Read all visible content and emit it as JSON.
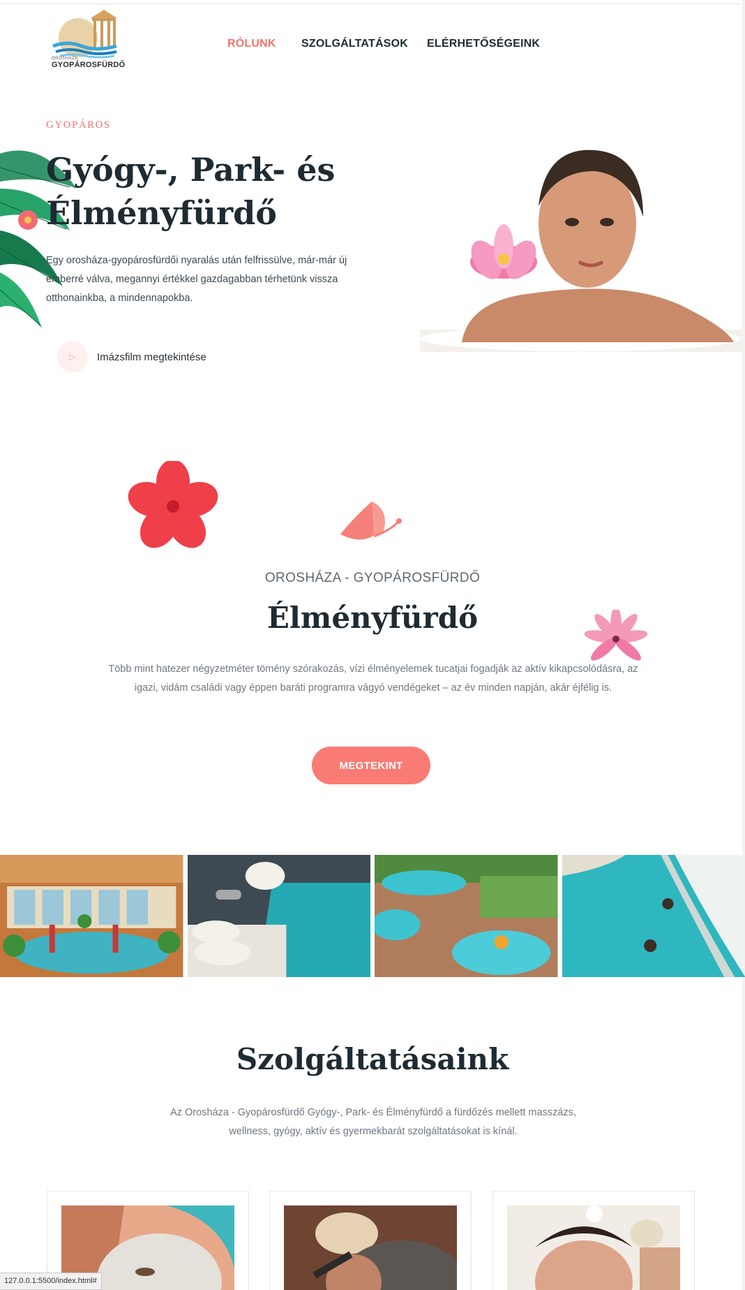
{
  "logo": {
    "small_text": "OROSHÁZA",
    "text": "GYOPÁROSFÜRDŐ"
  },
  "nav": {
    "items": [
      {
        "label": "RÓLUNK",
        "active": true
      },
      {
        "label": "SZOLGÁLTATÁSOK",
        "active": false
      },
      {
        "label": "ELÉRHETŐSÉGEINK",
        "active": false
      }
    ]
  },
  "hero": {
    "eyebrow": "GYOPÁROS",
    "title": "Gyógy-, Park- és Élményfürdő",
    "text": "Egy orosháza-gyopárosfürdői nyaralás után felfrissülve, már-már új emberré válva, megannyi értékkel gazdagabban térhetünk vissza otthonainkba, a mindennapokba.",
    "play_label": "Imázsfilm megtekintése"
  },
  "experience": {
    "eyebrow": "OROSHÁZA - GYOPÁROSFÜRDŐ",
    "title": "Élményfürdő",
    "text": "Több mint hatezer négyzetméter tömény szórakozás, vízi élményelemek tucatjai fogadják az aktív kikapcsolódásra, az igazi, vidám családi vagy éppen baráti programra vágyó vendégeket – az év minden napján, akár éjfélig is.",
    "cta": "MEGTEKINT"
  },
  "services": {
    "title": "Szolgáltatásaink",
    "text": "Az Orosháza - Gyopárosfürdő Gyógy-, Park- és Élményfürdő a fürdőzés mellett masszázs, wellness, gyógy, aktív és gyermekbarát szolgáltatásokat is kínál."
  },
  "status_bar": {
    "url": "127.0.0.1:5500/index.html#"
  },
  "colors": {
    "accent": "#f5716e",
    "button": "#fa7b74",
    "heading": "#1e2b33"
  },
  "icons": [
    "play-icon",
    "logo-image",
    "palm-leaf-decoration",
    "red-flower-decoration",
    "butterfly-icon",
    "pink-lotus-decoration"
  ]
}
